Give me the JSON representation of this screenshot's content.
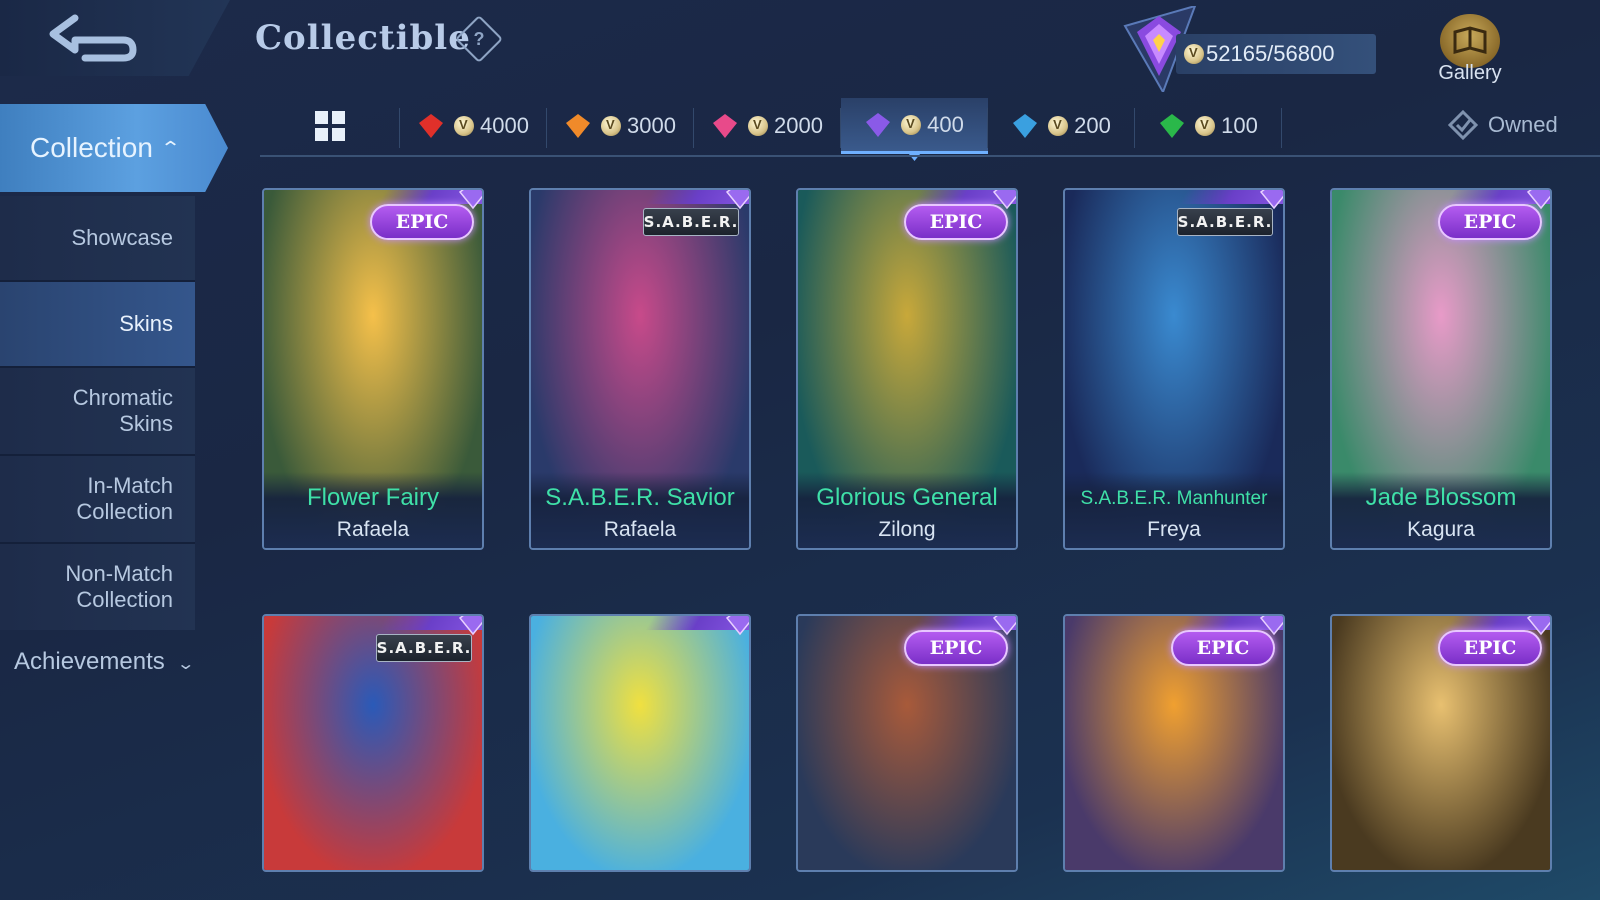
{
  "header": {
    "title": "Collectible",
    "points": "52165/56800",
    "gallery_label": "Gallery"
  },
  "sidebar": {
    "collection_label": "Collection",
    "items": [
      {
        "label_lines": [
          "Showcase"
        ]
      },
      {
        "label_lines": [
          "Skins"
        ]
      },
      {
        "label_lines": [
          "Chromatic",
          "Skins"
        ]
      },
      {
        "label_lines": [
          "In-Match",
          "Collection"
        ]
      },
      {
        "label_lines": [
          "Non-Match",
          "Collection"
        ]
      }
    ],
    "achievements_label": "Achievements"
  },
  "tabs": [
    {
      "value": "4000",
      "gem_color": "#e0302a"
    },
    {
      "value": "3000",
      "gem_color": "#f08a2a"
    },
    {
      "value": "2000",
      "gem_color": "#e84a8a"
    },
    {
      "value": "400",
      "gem_color": "#8a5ae8"
    },
    {
      "value": "200",
      "gem_color": "#3aa0e0"
    },
    {
      "value": "100",
      "gem_color": "#2ab84a"
    }
  ],
  "filter": {
    "owned_label": "Owned"
  },
  "cards": [
    {
      "badge": "EPIC",
      "skin": "Flower Fairy",
      "hero": "Rafaela",
      "colors": [
        "#f5c04a",
        "#3a5a3a"
      ]
    },
    {
      "badge": "S.A.B.E.R.",
      "skin": "S.A.B.E.R. Savior",
      "hero": "Rafaela",
      "colors": [
        "#c84a8a",
        "#2a3a6a"
      ]
    },
    {
      "badge": "EPIC",
      "skin": "Glorious General",
      "hero": "Zilong",
      "colors": [
        "#c8a83a",
        "#1a5a5a"
      ]
    },
    {
      "badge": "S.A.B.E.R.",
      "skin": "S.A.B.E.R. Manhunter",
      "hero": "Freya",
      "colors": [
        "#3a8ad0",
        "#1a2a5a"
      ]
    },
    {
      "badge": "EPIC",
      "skin": "Jade Blossom",
      "hero": "Kagura",
      "colors": [
        "#e89ac8",
        "#3a8a6a"
      ]
    },
    {
      "badge": "S.A.B.E.R.",
      "skin": "",
      "hero": "",
      "colors": [
        "#2a5ab8",
        "#c83a3a"
      ]
    },
    {
      "badge": "",
      "skin": "",
      "hero": "",
      "colors": [
        "#f0e040",
        "#4ab0e0"
      ]
    },
    {
      "badge": "EPIC",
      "skin": "",
      "hero": "",
      "colors": [
        "#a85a3a",
        "#2a3a5a"
      ]
    },
    {
      "badge": "EPIC",
      "skin": "",
      "hero": "",
      "colors": [
        "#f0a030",
        "#4a3a6a"
      ]
    },
    {
      "badge": "EPIC",
      "skin": "",
      "hero": "",
      "colors": [
        "#e8c070",
        "#4a3a20"
      ]
    }
  ]
}
